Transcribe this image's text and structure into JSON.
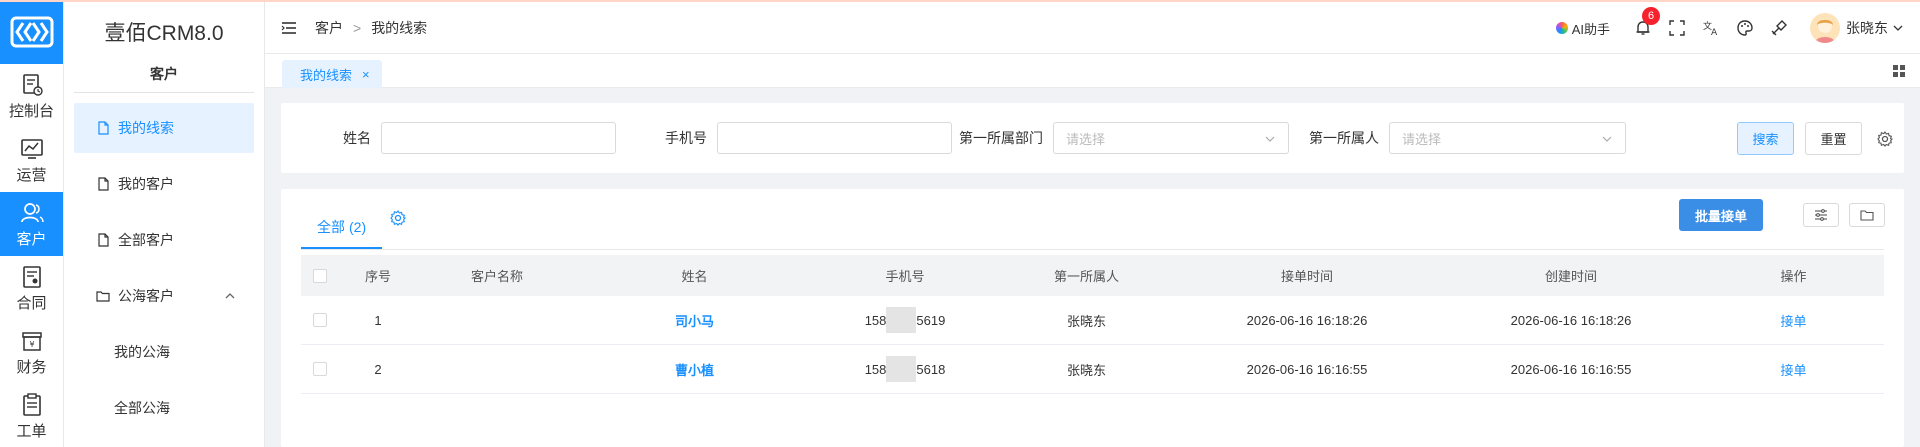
{
  "rail": {
    "items": [
      {
        "label": "控制台",
        "icon": "dashboard-icon"
      },
      {
        "label": "运营",
        "icon": "chart-icon"
      },
      {
        "label": "客户",
        "icon": "customer-icon",
        "active": true
      },
      {
        "label": "合同",
        "icon": "contract-icon"
      },
      {
        "label": "财务",
        "icon": "finance-icon"
      },
      {
        "label": "工单",
        "icon": "ticket-icon"
      }
    ]
  },
  "sidebar": {
    "app_title": "壹佰CRM8.0",
    "section": "客户",
    "items": [
      {
        "label": "我的线索",
        "active": true
      },
      {
        "label": "我的客户"
      },
      {
        "label": "全部客户"
      }
    ],
    "group": {
      "label": "公海客户",
      "expanded": true,
      "children": [
        "我的公海",
        "全部公海"
      ]
    }
  },
  "header": {
    "breadcrumb": [
      "客户",
      "我的线索"
    ],
    "breadcrumb_sep": ">",
    "ai_label": "AI助手",
    "notification_count": "6",
    "user_name": "张晓东"
  },
  "page_tab": {
    "label": "我的线索",
    "close": "×"
  },
  "filter": {
    "name_label": "姓名",
    "name_value": "",
    "phone_label": "手机号",
    "phone_value": "",
    "dept_label": "第一所属部门",
    "dept_placeholder": "请选择",
    "owner_label": "第一所属人",
    "owner_placeholder": "请选择",
    "search_button": "搜索",
    "reset_button": "重置"
  },
  "list": {
    "tab_label": "全部",
    "tab_count": "(2)",
    "batch_button": "批量接单",
    "columns": [
      "序号",
      "客户名称",
      "姓名",
      "手机号",
      "第一所属人",
      "接单时间",
      "创建时间",
      "操作"
    ],
    "rows": [
      {
        "no": "1",
        "customer": "",
        "name": "司小马",
        "phone_prefix": "158",
        "phone_suffix": "5619",
        "owner": "张晓东",
        "accept_time": "2026-06-16 16:18:26",
        "create_time": "2026-06-16 16:18:26",
        "action": "接单"
      },
      {
        "no": "2",
        "customer": "",
        "name": "曹小植",
        "phone_prefix": "158",
        "phone_suffix": "5618",
        "owner": "张晓东",
        "accept_time": "2026-06-16 16:16:55",
        "create_time": "2026-06-16 16:16:55",
        "action": "接单"
      }
    ]
  },
  "colors": {
    "primary": "#1890ff",
    "batch": "#3a8ee6",
    "badge": "#f5222d"
  }
}
